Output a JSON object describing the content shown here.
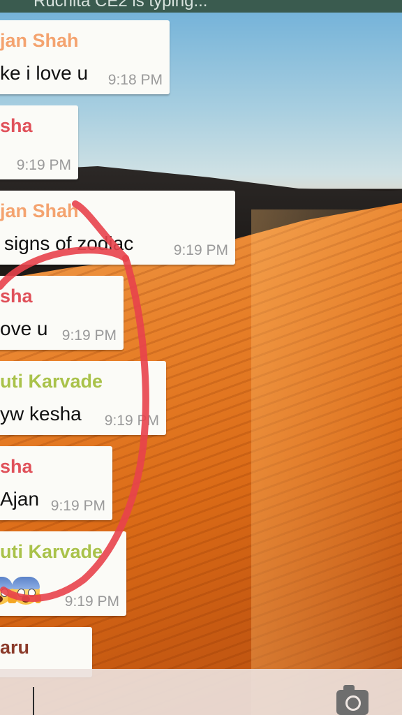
{
  "status_bar": {
    "typing_text": "Ruchita CE2 is typing..."
  },
  "messages": [
    {
      "sender": "jan Shah",
      "sender_color": "#f4a36f",
      "text": "ke i love u",
      "time": "9:18 PM"
    },
    {
      "sender": "sha",
      "sender_color": "#e0515a",
      "text": "",
      "time": "9:19 PM"
    },
    {
      "sender": "jan Shah",
      "sender_color": "#f4a36f",
      "text": "signs of zodiac",
      "time": "9:19 PM"
    },
    {
      "sender": "sha",
      "sender_color": "#e0515a",
      "text": "ove u",
      "time": "9:19 PM"
    },
    {
      "sender": "uti Karvade",
      "sender_color": "#a9c24a",
      "text": "yw kesha",
      "time": "9:19 PM"
    },
    {
      "sender": "sha",
      "sender_color": "#e0515a",
      "text": "Ajan",
      "time": "9:19 PM"
    },
    {
      "sender": "uti Karvade",
      "sender_color": "#a9c24a",
      "text": "",
      "emojis": [
        "screaming-face-emoji",
        "screaming-face-emoji"
      ],
      "time": "9:19 PM"
    },
    {
      "sender": "aru",
      "sender_color": "#8b3a2a",
      "text": "",
      "time": ""
    }
  ],
  "input_bar": {
    "icon": "camera-icon"
  }
}
